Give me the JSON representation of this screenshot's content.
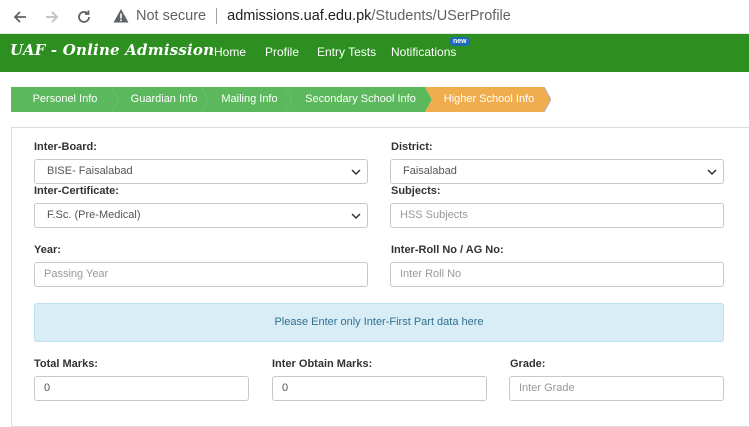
{
  "browser": {
    "security_text": "Not secure",
    "url_host": "admissions.uaf.edu.pk",
    "url_path": "/Students/USerProfile"
  },
  "header": {
    "brand": "UAF - Online Admission",
    "nav": [
      "Home",
      "Profile",
      "Entry Tests",
      "Notifications"
    ],
    "badge": "new",
    "color": "#2c8f1f"
  },
  "steps": [
    {
      "label": "Personel Info",
      "state": "done"
    },
    {
      "label": "Guardian Info",
      "state": "done"
    },
    {
      "label": "Mailing Info",
      "state": "done"
    },
    {
      "label": "Secondary School Info",
      "state": "done"
    },
    {
      "label": "Higher School Info",
      "state": "active"
    }
  ],
  "step_colors": {
    "done": "#5cb85c",
    "active": "#f0ad4e"
  },
  "form": {
    "inter_board": {
      "label": "Inter-Board:",
      "value": "BISE- Faisalabad"
    },
    "district": {
      "label": "District:",
      "value": "Faisalabad"
    },
    "inter_certificate": {
      "label": "Inter-Certificate:",
      "value": "F.Sc. (Pre-Medical)"
    },
    "subjects": {
      "label": "Subjects:",
      "placeholder": "HSS Subjects"
    },
    "year": {
      "label": "Year:",
      "placeholder": "Passing Year"
    },
    "roll_no": {
      "label": "Inter-Roll No / AG No:",
      "placeholder": "Inter Roll No"
    },
    "notice": "Please Enter only Inter-First Part data here",
    "total_marks": {
      "label": "Total Marks:",
      "value": "0"
    },
    "obtain_marks": {
      "label": "Inter Obtain Marks:",
      "value": "0"
    },
    "grade": {
      "label": "Grade:",
      "placeholder": "Inter Grade"
    }
  }
}
